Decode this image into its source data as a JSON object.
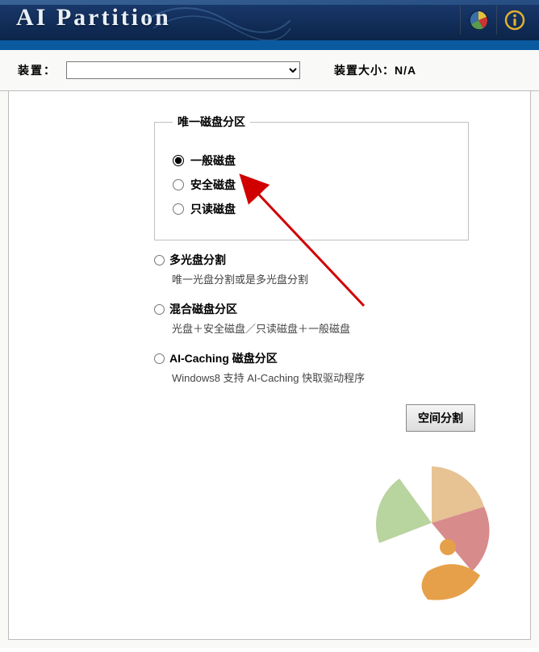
{
  "header": {
    "brand": "AI Partition",
    "icons": {
      "pie": "pie-icon",
      "info": "info-icon"
    }
  },
  "device": {
    "label": "装置：",
    "selected": "",
    "size_label": "装置大小：",
    "size_value": "N/A"
  },
  "group": {
    "legend": "唯一磁盘分区",
    "options": [
      {
        "id": "normal",
        "label": "一般磁盘",
        "checked": true
      },
      {
        "id": "secure",
        "label": "安全磁盘",
        "checked": false
      },
      {
        "id": "readonly",
        "label": "只读磁盘",
        "checked": false
      }
    ]
  },
  "outer": [
    {
      "id": "multi",
      "label": "多光盘分割",
      "desc": "唯一光盘分割或是多光盘分割",
      "checked": false
    },
    {
      "id": "mixed",
      "label": "混合磁盘分区",
      "desc": "光盘＋安全磁盘／只读磁盘＋一般磁盘",
      "checked": false
    },
    {
      "id": "aicache",
      "label": "AI-Caching 磁盘分区",
      "desc": "Windows8 支持 AI-Caching 快取驱动程序",
      "checked": false
    }
  ],
  "button": {
    "space_split": "空间分割"
  }
}
